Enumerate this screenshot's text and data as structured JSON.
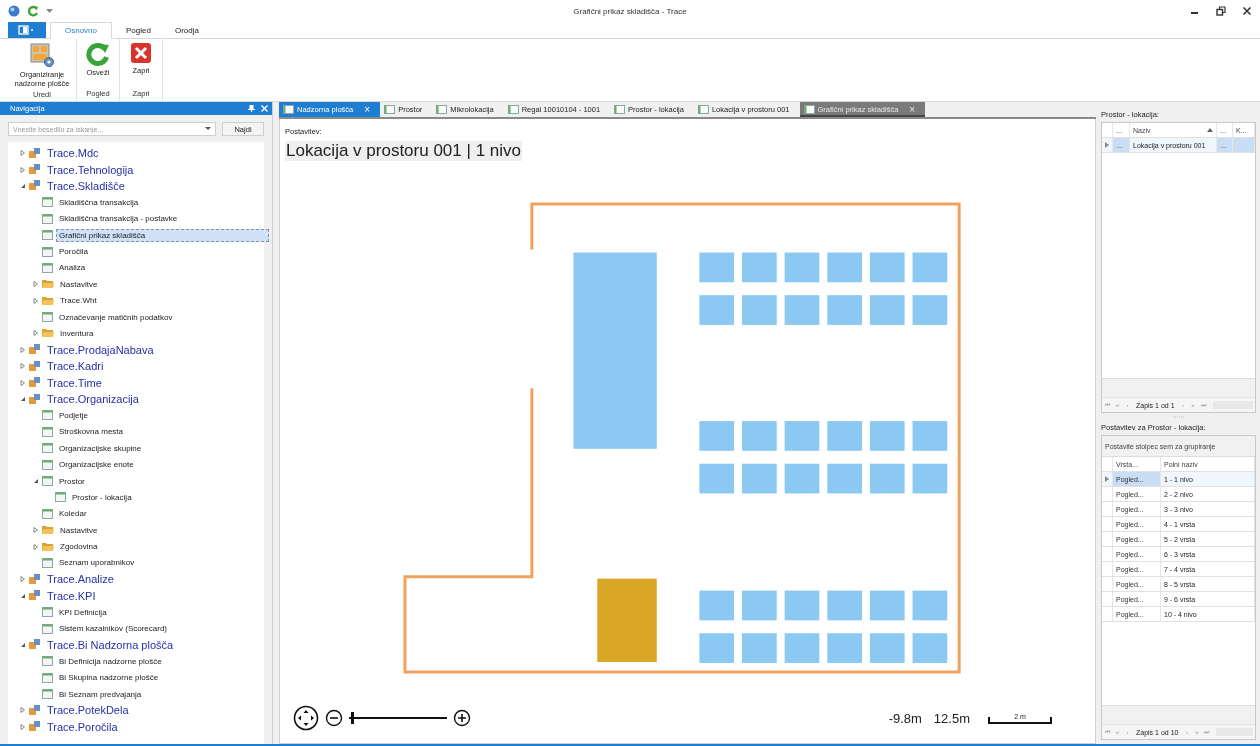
{
  "window": {
    "title": "Grafični prikaz skladišča - Trace"
  },
  "ribbon": {
    "tabs": [
      {
        "label": "Osnovno",
        "selected": true
      },
      {
        "label": "Pogled",
        "selected": false
      },
      {
        "label": "Orodja",
        "selected": false
      }
    ],
    "groups": [
      {
        "label": "Uredi",
        "buttons": [
          {
            "label": "Organiziranje nadzorne plošče",
            "kind": "organize"
          }
        ]
      },
      {
        "label": "Pogled",
        "buttons": [
          {
            "label": "Osveži",
            "kind": "refresh"
          }
        ]
      },
      {
        "label": "Zapri",
        "buttons": [
          {
            "label": "Zapri",
            "kind": "close"
          }
        ]
      }
    ]
  },
  "navigation": {
    "title": "Navigacija",
    "search": {
      "placeholder": "Vnesite besedilo za iskanje...",
      "button": "Najdi"
    },
    "tree": [
      {
        "label": "Trace.Mdc",
        "kind": "module",
        "expanded": false,
        "selected": false
      },
      {
        "label": "Trace.Tehnologija",
        "kind": "module",
        "expanded": false,
        "selected": false
      },
      {
        "label": "Trace.Skladišče",
        "kind": "module",
        "expanded": true,
        "selected": false,
        "children": [
          {
            "label": "Skladiščna transakcija",
            "kind": "item",
            "selected": false
          },
          {
            "label": "Skladiščna transakcija - postavke",
            "kind": "item",
            "selected": false
          },
          {
            "label": "Grafični prikaz skladišča",
            "kind": "item",
            "selected": true
          },
          {
            "label": "Poročila",
            "kind": "item",
            "selected": false
          },
          {
            "label": "Analiza",
            "kind": "item",
            "selected": false
          },
          {
            "label": "Nastavitve",
            "kind": "folder",
            "expanded": false,
            "selected": false
          },
          {
            "label": "Trace.Wht",
            "kind": "folder",
            "expanded": false,
            "selected": false
          },
          {
            "label": "Označevanje matičnih podatkov",
            "kind": "item",
            "selected": false
          },
          {
            "label": "Inventura",
            "kind": "folder",
            "expanded": false,
            "selected": false
          }
        ]
      },
      {
        "label": "Trace.ProdajaNabava",
        "kind": "module",
        "expanded": false,
        "selected": false
      },
      {
        "label": "Trace.Kadri",
        "kind": "module",
        "expanded": false,
        "selected": false
      },
      {
        "label": "Trace.Time",
        "kind": "module",
        "expanded": false,
        "selected": false
      },
      {
        "label": "Trace.Organizacija",
        "kind": "module",
        "expanded": true,
        "selected": false,
        "children": [
          {
            "label": "Podjetje",
            "kind": "item",
            "selected": false
          },
          {
            "label": "Stroškovna mesta",
            "kind": "item",
            "selected": false
          },
          {
            "label": "Organizacijske skupine",
            "kind": "item",
            "selected": false
          },
          {
            "label": "Organizacijske enote",
            "kind": "item",
            "selected": false
          },
          {
            "label": "Prostor",
            "kind": "item",
            "expanded": true,
            "selected": false,
            "children": [
              {
                "label": "Prostor - lokacija",
                "kind": "item",
                "selected": false
              }
            ]
          },
          {
            "label": "Koledar",
            "kind": "item",
            "selected": false
          },
          {
            "label": "Nastavitve",
            "kind": "folder",
            "expanded": false,
            "selected": false
          },
          {
            "label": "Zgodovina",
            "kind": "folder",
            "expanded": false,
            "selected": false
          },
          {
            "label": "Seznam uporabnikov",
            "kind": "item",
            "selected": false
          }
        ]
      },
      {
        "label": "Trace.Analize",
        "kind": "module",
        "expanded": false,
        "selected": false
      },
      {
        "label": "Trace.KPI",
        "kind": "module",
        "expanded": true,
        "selected": false,
        "children": [
          {
            "label": "KPI Definicija",
            "kind": "item",
            "selected": false
          },
          {
            "label": "Sistem kazalnikov  (Scorecard)",
            "kind": "item",
            "selected": false
          }
        ]
      },
      {
        "label": "Trace.Bi Nadzorna plošča",
        "kind": "module",
        "expanded": true,
        "selected": false,
        "children": [
          {
            "label": "Bi Definicija nadzorne plošče",
            "kind": "item",
            "selected": false
          },
          {
            "label": "Bi Skupina nadzorne plošče",
            "kind": "item",
            "selected": false
          },
          {
            "label": "Bi Seznam predvajanja",
            "kind": "item",
            "selected": false
          }
        ]
      },
      {
        "label": "Trace.PotekDela",
        "kind": "module",
        "expanded": false,
        "selected": false
      },
      {
        "label": "Trace.Poročila",
        "kind": "module",
        "expanded": false,
        "selected": false
      }
    ]
  },
  "document_tabs": [
    {
      "label": "Nadzorna plošča",
      "selected": true,
      "active": false,
      "close": "×"
    },
    {
      "label": "Prostor",
      "selected": false,
      "active": false
    },
    {
      "label": "Mikrolokacija",
      "selected": false,
      "active": false
    },
    {
      "label": "Regal 10010104 - 1001",
      "selected": false,
      "active": false
    },
    {
      "label": "Prostor - lokacija",
      "selected": false,
      "active": false
    },
    {
      "label": "Lokacija v prostoru 001",
      "selected": false,
      "active": false
    },
    {
      "label": "Grafični prikaz skladišča",
      "selected": false,
      "active": true,
      "close": "×"
    }
  ],
  "layout": {
    "label": "Postavitev:",
    "title": "Lokacija v prostoru 001 | 1 nivo",
    "zoom": {
      "level": 0.03
    },
    "scale": {
      "min": "-9.8m",
      "max": "12.5m",
      "bar": "2 m"
    }
  },
  "location_panel": {
    "title": "Prostor - lokacija:",
    "columns": [
      "...",
      "Naziv",
      "...",
      "K..."
    ],
    "rows": [
      {
        "cells": [
          "...",
          "Lokacija v prostoru 001",
          "..."
        ],
        "selected": true
      }
    ],
    "pager": {
      "before": [
        "⏮",
        "«",
        "‹"
      ],
      "text": "Zapis 1 od 1",
      "after": [
        "›",
        "»",
        "⏭"
      ]
    }
  },
  "layout_panel": {
    "title": "Postavitev za Prostor - lokacija:",
    "group_hint": "Postavite stolpec sem za grupiranje",
    "columns": [
      "Vrsta...",
      "Polni naziv"
    ],
    "rows": [
      {
        "cells": [
          "Pogled...",
          "1 - 1 nivo"
        ],
        "selected": true
      },
      {
        "cells": [
          "Pogled...",
          "2 - 2 nivo"
        ],
        "selected": false
      },
      {
        "cells": [
          "Pogled...",
          "3 - 3 nivo"
        ],
        "selected": false
      },
      {
        "cells": [
          "Pogled...",
          "4 - 1 vrsta"
        ],
        "selected": false
      },
      {
        "cells": [
          "Pogled...",
          "5 - 2 vrsta"
        ],
        "selected": false
      },
      {
        "cells": [
          "Pogled...",
          "6 - 3 vrsta"
        ],
        "selected": false
      },
      {
        "cells": [
          "Pogled...",
          "7 - 4 vrsta"
        ],
        "selected": false
      },
      {
        "cells": [
          "Pogled...",
          "8 - 5 vrsta"
        ],
        "selected": false
      },
      {
        "cells": [
          "Pogled...",
          "9 - 6 vrsta"
        ],
        "selected": false
      },
      {
        "cells": [
          "Pogled...",
          "10 - 4 nivo"
        ],
        "selected": false
      }
    ],
    "pager": {
      "before": [
        "⏮",
        "«",
        "‹"
      ],
      "text": "Zapis 1 od 10",
      "after": [
        "›",
        "»",
        "⏭"
      ]
    }
  }
}
